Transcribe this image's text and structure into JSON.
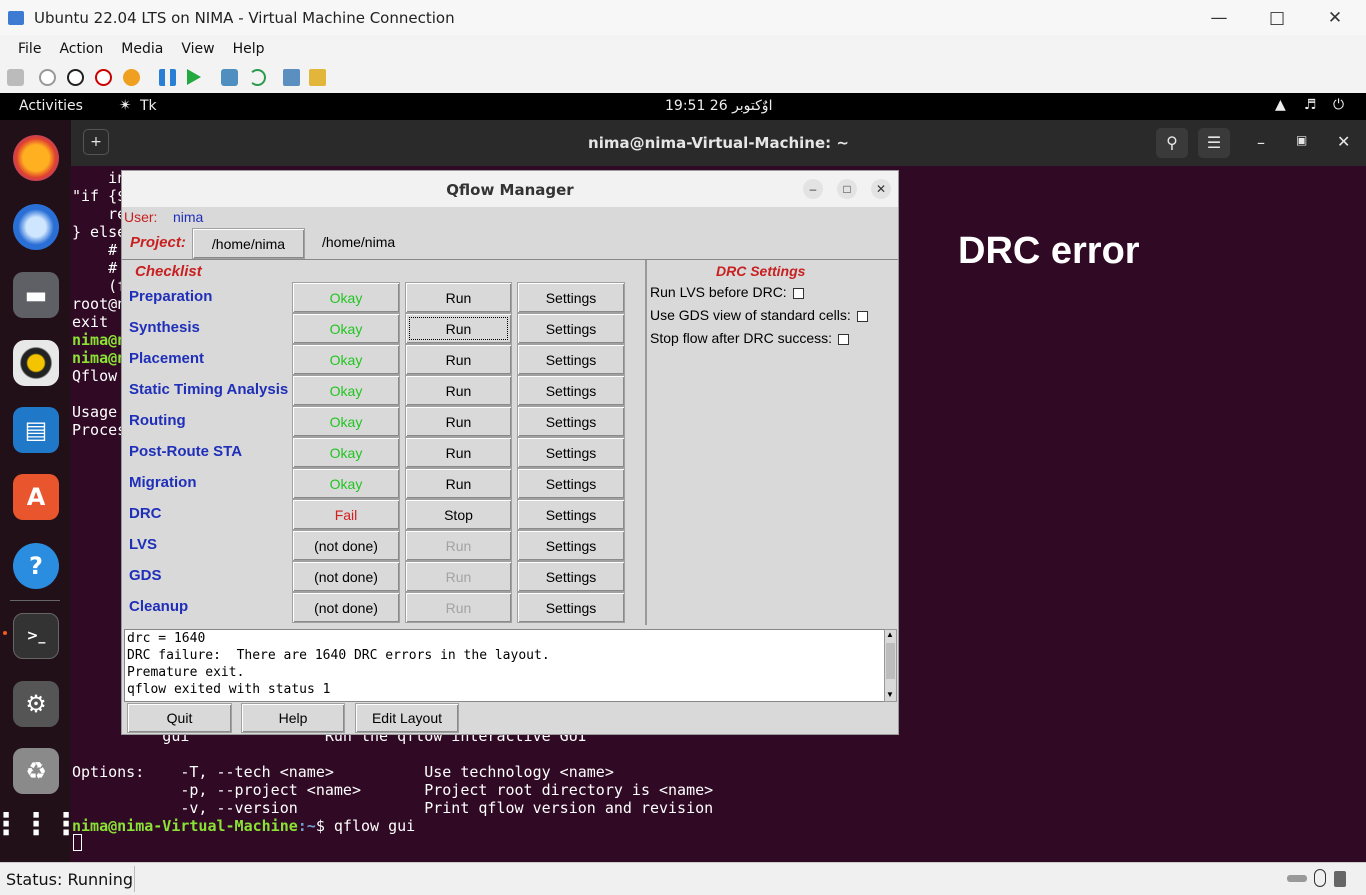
{
  "host": {
    "title": "Ubuntu 22.04 LTS on NIMA - Virtual Machine Connection",
    "menu": [
      "File",
      "Action",
      "Media",
      "View",
      "Help"
    ],
    "status": "Status: Running"
  },
  "gnome": {
    "activities": "Activities",
    "app_name": "Tk",
    "clock": "19:51 26 اوٌکتوبر"
  },
  "terminal": {
    "title": "nima@nima-Virtual-Machine: ~",
    "lines_top": [
      "    in",
      "\"if {$",
      "    re",
      "} else",
      "    #",
      "    #",
      "    (f",
      "root@n",
      "exit",
      "nima@n",
      "nima@n",
      "Qflow",
      "",
      "Usage",
      "Proces"
    ],
    "lines_bottom": [
      "          gui               Run the qflow interactive GUI",
      "",
      "Options:    -T, --tech <name>          Use technology <name>",
      "            -p, --project <name>       Project root directory is <name>",
      "            -v, --version              Print qflow version and revision"
    ],
    "prompt_user": "nima@nima-Virtual-Machine",
    "prompt_path": ":~",
    "prompt_cmd": "$ qflow gui"
  },
  "overlay": {
    "label": "DRC error"
  },
  "qflow": {
    "title": "Qflow Manager",
    "user_label": "User:",
    "user_value": "nima",
    "project_label": "Project:",
    "project_button": "/home/nima",
    "project_path": "/home/nima",
    "checklist_title": "Checklist",
    "steps": [
      {
        "name": "Preparation",
        "status": "Okay",
        "action": "Run",
        "settings": "Settings"
      },
      {
        "name": "Synthesis",
        "status": "Okay",
        "action": "Run",
        "settings": "Settings"
      },
      {
        "name": "Placement",
        "status": "Okay",
        "action": "Run",
        "settings": "Settings"
      },
      {
        "name": "Static Timing Analysis",
        "status": "Okay",
        "action": "Run",
        "settings": "Settings"
      },
      {
        "name": "Routing",
        "status": "Okay",
        "action": "Run",
        "settings": "Settings"
      },
      {
        "name": "Post-Route STA",
        "status": "Okay",
        "action": "Run",
        "settings": "Settings"
      },
      {
        "name": "Migration",
        "status": "Okay",
        "action": "Run",
        "settings": "Settings"
      },
      {
        "name": "DRC",
        "status": "Fail",
        "action": "Stop",
        "settings": "Settings"
      },
      {
        "name": "LVS",
        "status": "(not done)",
        "action": "Run",
        "settings": "Settings"
      },
      {
        "name": "GDS",
        "status": "(not done)",
        "action": "Run",
        "settings": "Settings"
      },
      {
        "name": "Cleanup",
        "status": "(not done)",
        "action": "Run",
        "settings": "Settings"
      }
    ],
    "drc_settings": {
      "title": "DRC Settings",
      "options": [
        "Run LVS before DRC:",
        "Use GDS view of standard cells:",
        "Stop flow after DRC success:"
      ]
    },
    "log": [
      "drc = 1640",
      "DRC failure:  There are 1640 DRC errors in the layout.",
      "Premature exit.",
      "qflow exited with status 1"
    ],
    "bottom_buttons": [
      "Quit",
      "Help",
      "Edit Layout"
    ]
  },
  "colors": {
    "ok": "#21c521",
    "fail": "#d41e1e",
    "step": "#1f2fb8",
    "terminal_bg": "#300a24"
  }
}
